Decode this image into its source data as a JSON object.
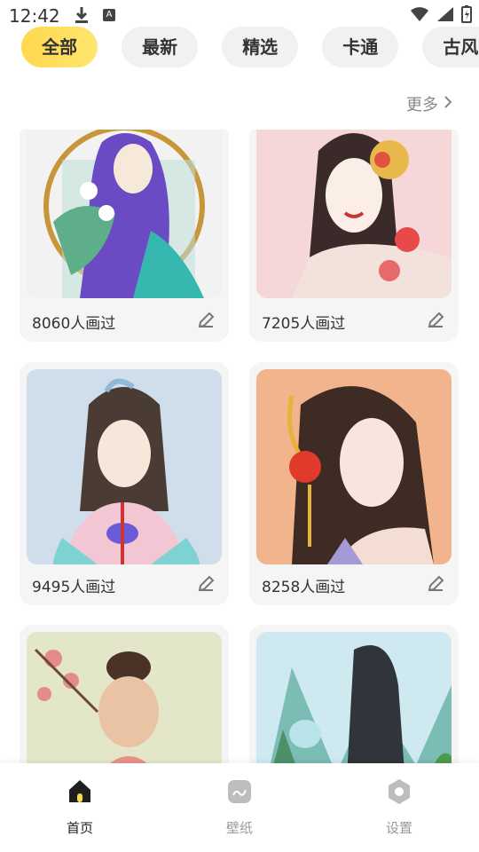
{
  "status": {
    "time": "12:42"
  },
  "chips": [
    "全部",
    "最新",
    "精选",
    "卡通",
    "古风"
  ],
  "more_label": "更多",
  "cards": [
    {
      "count": "8060人画过"
    },
    {
      "count": "7205人画过"
    },
    {
      "count": "9495人画过"
    },
    {
      "count": "8258人画过"
    },
    {
      "count": ""
    },
    {
      "count": ""
    }
  ],
  "nav": {
    "home": "首页",
    "wallpaper": "壁纸",
    "settings": "设置"
  },
  "colors": {
    "accent": "#ffd84d",
    "chip_bg": "#f1f1f1",
    "card_bg": "#f5f5f5"
  }
}
